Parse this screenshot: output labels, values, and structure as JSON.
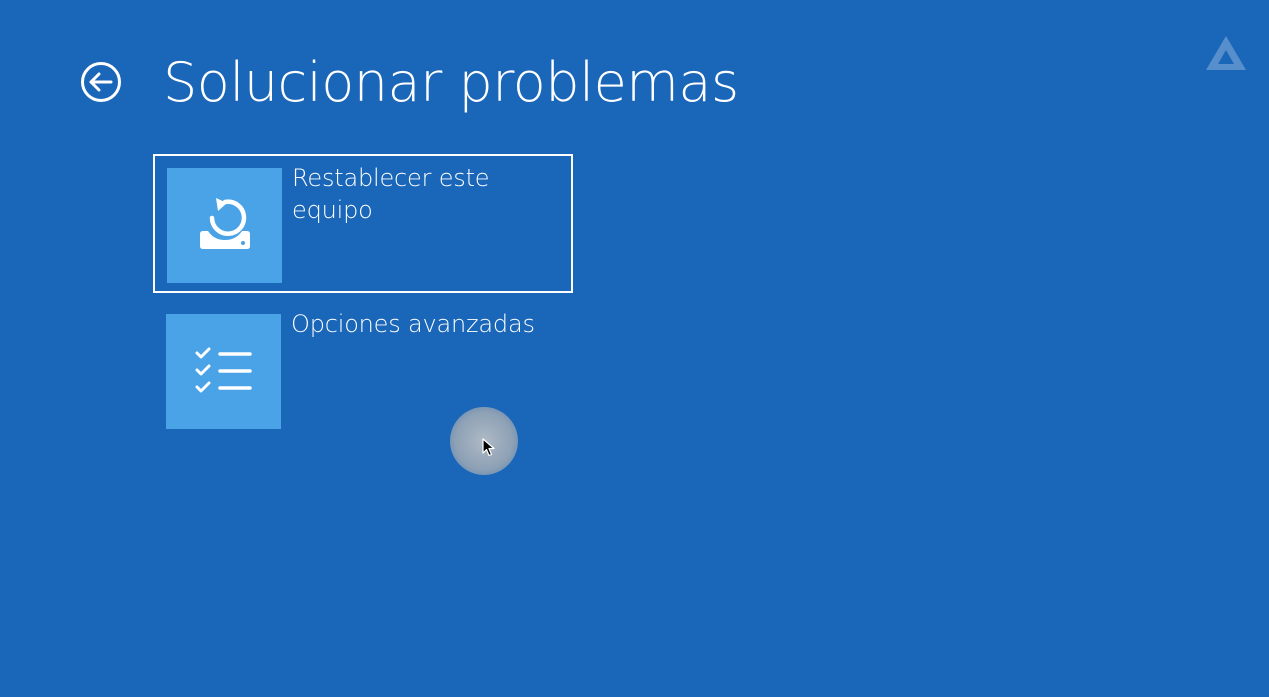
{
  "header": {
    "title": "Solucionar problemas",
    "back_icon": "back-arrow-icon"
  },
  "options": [
    {
      "label": "Restablecer este equipo",
      "icon": "reset-pc-icon",
      "selected": true
    },
    {
      "label": "Opciones avanzadas",
      "icon": "checklist-icon",
      "selected": false
    }
  ],
  "colors": {
    "background": "#1a66b8",
    "tile": "#4aa3e6",
    "text": "#ffffff"
  }
}
